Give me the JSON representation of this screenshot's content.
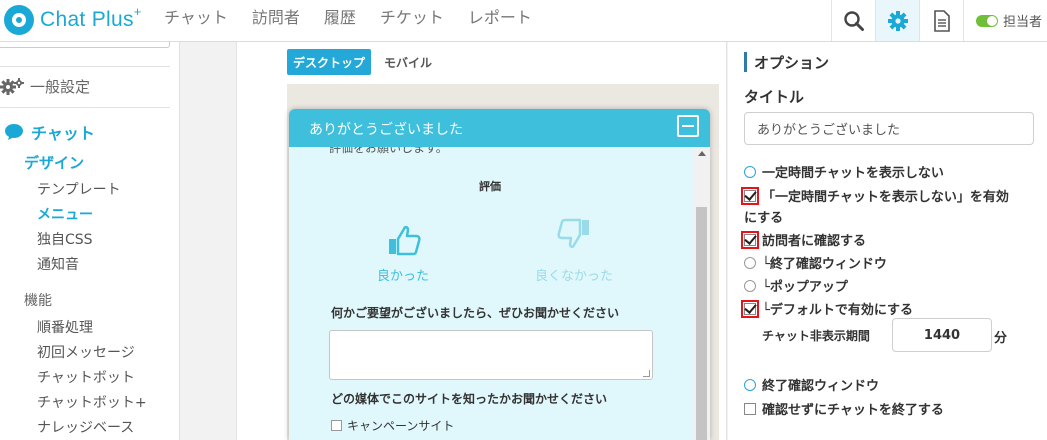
{
  "header": {
    "logo_text": "Chat Plus",
    "logo_sup": "+",
    "nav": [
      "チャット",
      "訪問者",
      "履歴",
      "チケット",
      "レポート"
    ],
    "status_label": "担当者"
  },
  "sidebar": {
    "general_settings": "一般設定",
    "chat": "チャット",
    "design": "デザイン",
    "design_items": [
      "テンプレート",
      "メニュー",
      "独自CSS",
      "通知音"
    ],
    "functions": "機能",
    "function_items": [
      "順番処理",
      "初回メッセージ",
      "チャットボット",
      "チャットボット+",
      "ナレッジベース"
    ]
  },
  "tabs": {
    "desktop": "デスクトップ",
    "mobile": "モバイル"
  },
  "widget": {
    "title": "ありがとうございました",
    "cut_text": "評価をお願いします。",
    "rating_label": "評価",
    "good": "良かった",
    "bad": "良くなかった",
    "request_label": "何かご要望がございましたら、ぜひお聞かせください",
    "media_label": "どの媒体でこのサイトを知ったかお聞かせください",
    "campaign_option": "キャンペーンサイト"
  },
  "options": {
    "heading": "オプション",
    "title_label": "タイトル",
    "title_value": "ありがとうございました",
    "hide_chat": "一定時間チャットを表示しない",
    "enable_hide_1": "「一定時間チャットを表示しない」を有効",
    "enable_hide_2": "にする",
    "confirm_visitor": "訪問者に確認する",
    "end_confirm_window_sub": "└終了確認ウィンドウ",
    "popup_sub": "└ポップアップ",
    "default_enabled": "└デフォルトで有効にする",
    "period_label": "チャット非表示期間",
    "period_value": "1440",
    "period_unit": "分",
    "end_confirm_window": "終了確認ウィンドウ",
    "end_without_confirm": "確認せずにチャットを終了する"
  },
  "colors": {
    "brand": "#1aa9d6",
    "widget_header": "#3ebfdc",
    "highlight": "#e8121c"
  }
}
